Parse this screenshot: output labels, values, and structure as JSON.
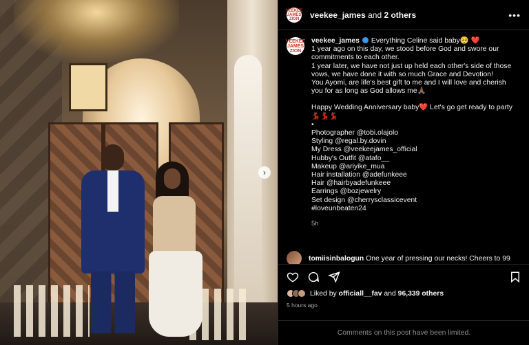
{
  "post": {
    "author_avatar_text": "VEEKEE JAMES ZION",
    "header": {
      "username": "veekee_james",
      "joiner": "and",
      "others": "2 others",
      "more_icon": "more-horizontal-icon"
    },
    "caption": {
      "username": "veekee_james",
      "lines": [
        "Everything Celine said baby🥺 ❤️",
        "1 year ago on this day, we stood before God and swore our",
        "commitments to each other.",
        "1 year later, we have not just up held each other's side of those",
        "vows, we have done it with so much Grace and Devotion!",
        "You Ayomi, are life's best gift to me and I will love and cherish",
        "you for as long as God allows me🙏🏾",
        "",
        "Happy Wedding Anniversary baby❤️  Let's go get ready to party",
        "💃🏾💃🏾💃🏾",
        "•",
        "Photographer @tobi.olajolo",
        "Styling @regal.by.dovin",
        "My Dress @veekeejames_official",
        "Hubby's Outfit @atafo__",
        "Makeup @ariyike_mua",
        "Hair installation @adefunkeee",
        "Hair @hairbyadefunkeee",
        "Earrings @bozjewelry",
        "Set design @cherrysclassicevent",
        "#loveunbeaten24"
      ],
      "time": "5h"
    },
    "comment": {
      "username": "tomiisinbalogun",
      "text": "One year of pressing our necks! Cheers to 99"
    },
    "likes": {
      "prefix": "Liked by",
      "user": "officiall__fav",
      "joiner": "and",
      "count": "96,339 others"
    },
    "posted_ago": "5 hours ago",
    "comments_limited": "Comments on this post have been limited."
  }
}
